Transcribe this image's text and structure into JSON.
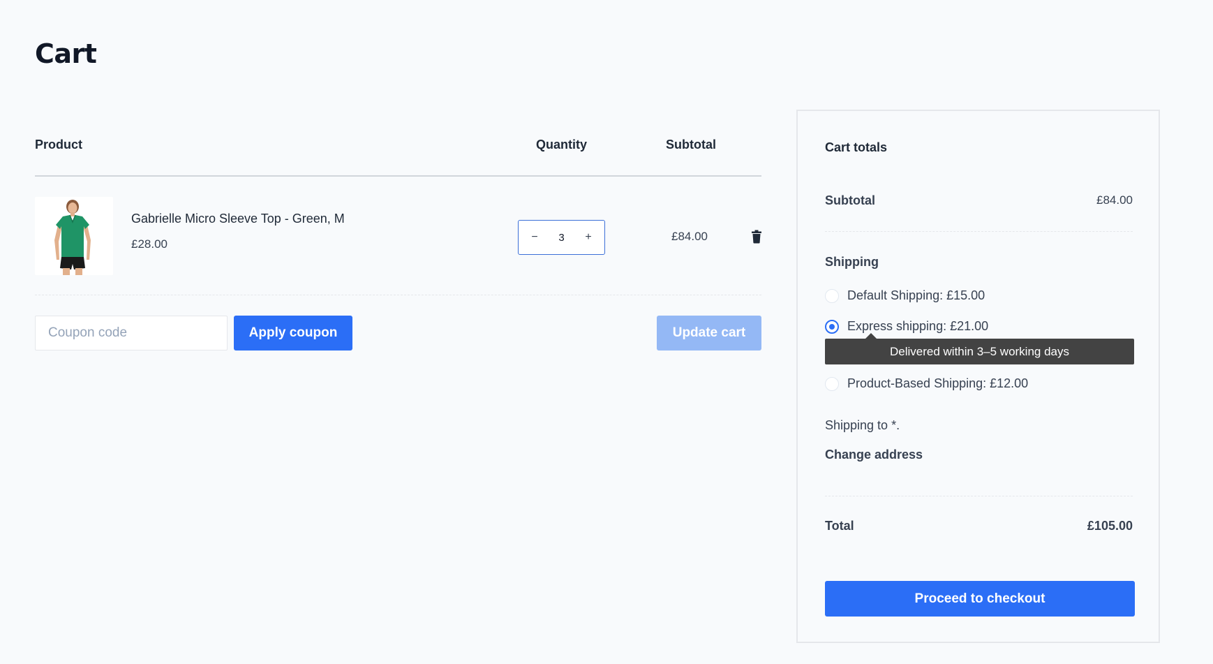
{
  "page": {
    "title": "Cart"
  },
  "cart": {
    "headers": {
      "product": "Product",
      "quantity": "Quantity",
      "subtotal": "Subtotal"
    },
    "items": [
      {
        "name": "Gabrielle Micro Sleeve Top - Green, M",
        "price": "£28.00",
        "quantity": "3",
        "subtotal": "£84.00",
        "image_icon": "green-shirt-image"
      }
    ],
    "coupon": {
      "placeholder": "Coupon code",
      "value": ""
    },
    "apply_label": "Apply coupon",
    "update_label": "Update cart"
  },
  "totals": {
    "title": "Cart totals",
    "subtotal_label": "Subtotal",
    "subtotal_value": "£84.00",
    "shipping_label": "Shipping",
    "options": [
      {
        "label": "Default Shipping: £15.00",
        "selected": false
      },
      {
        "label": "Express shipping: £21.00",
        "selected": true
      },
      {
        "label": "Product-Based Shipping: £12.00",
        "selected": false
      }
    ],
    "tooltip": "Delivered within 3–5 working days",
    "shipping_to": "Shipping to *.",
    "change_address": "Change address",
    "total_label": "Total",
    "total_value": "£105.00",
    "checkout_label": "Proceed to checkout"
  },
  "colors": {
    "accent": "#2b6ef6",
    "accent_disabled": "#94b8f5",
    "tooltip_bg": "#434343",
    "background": "#f8fafc"
  }
}
